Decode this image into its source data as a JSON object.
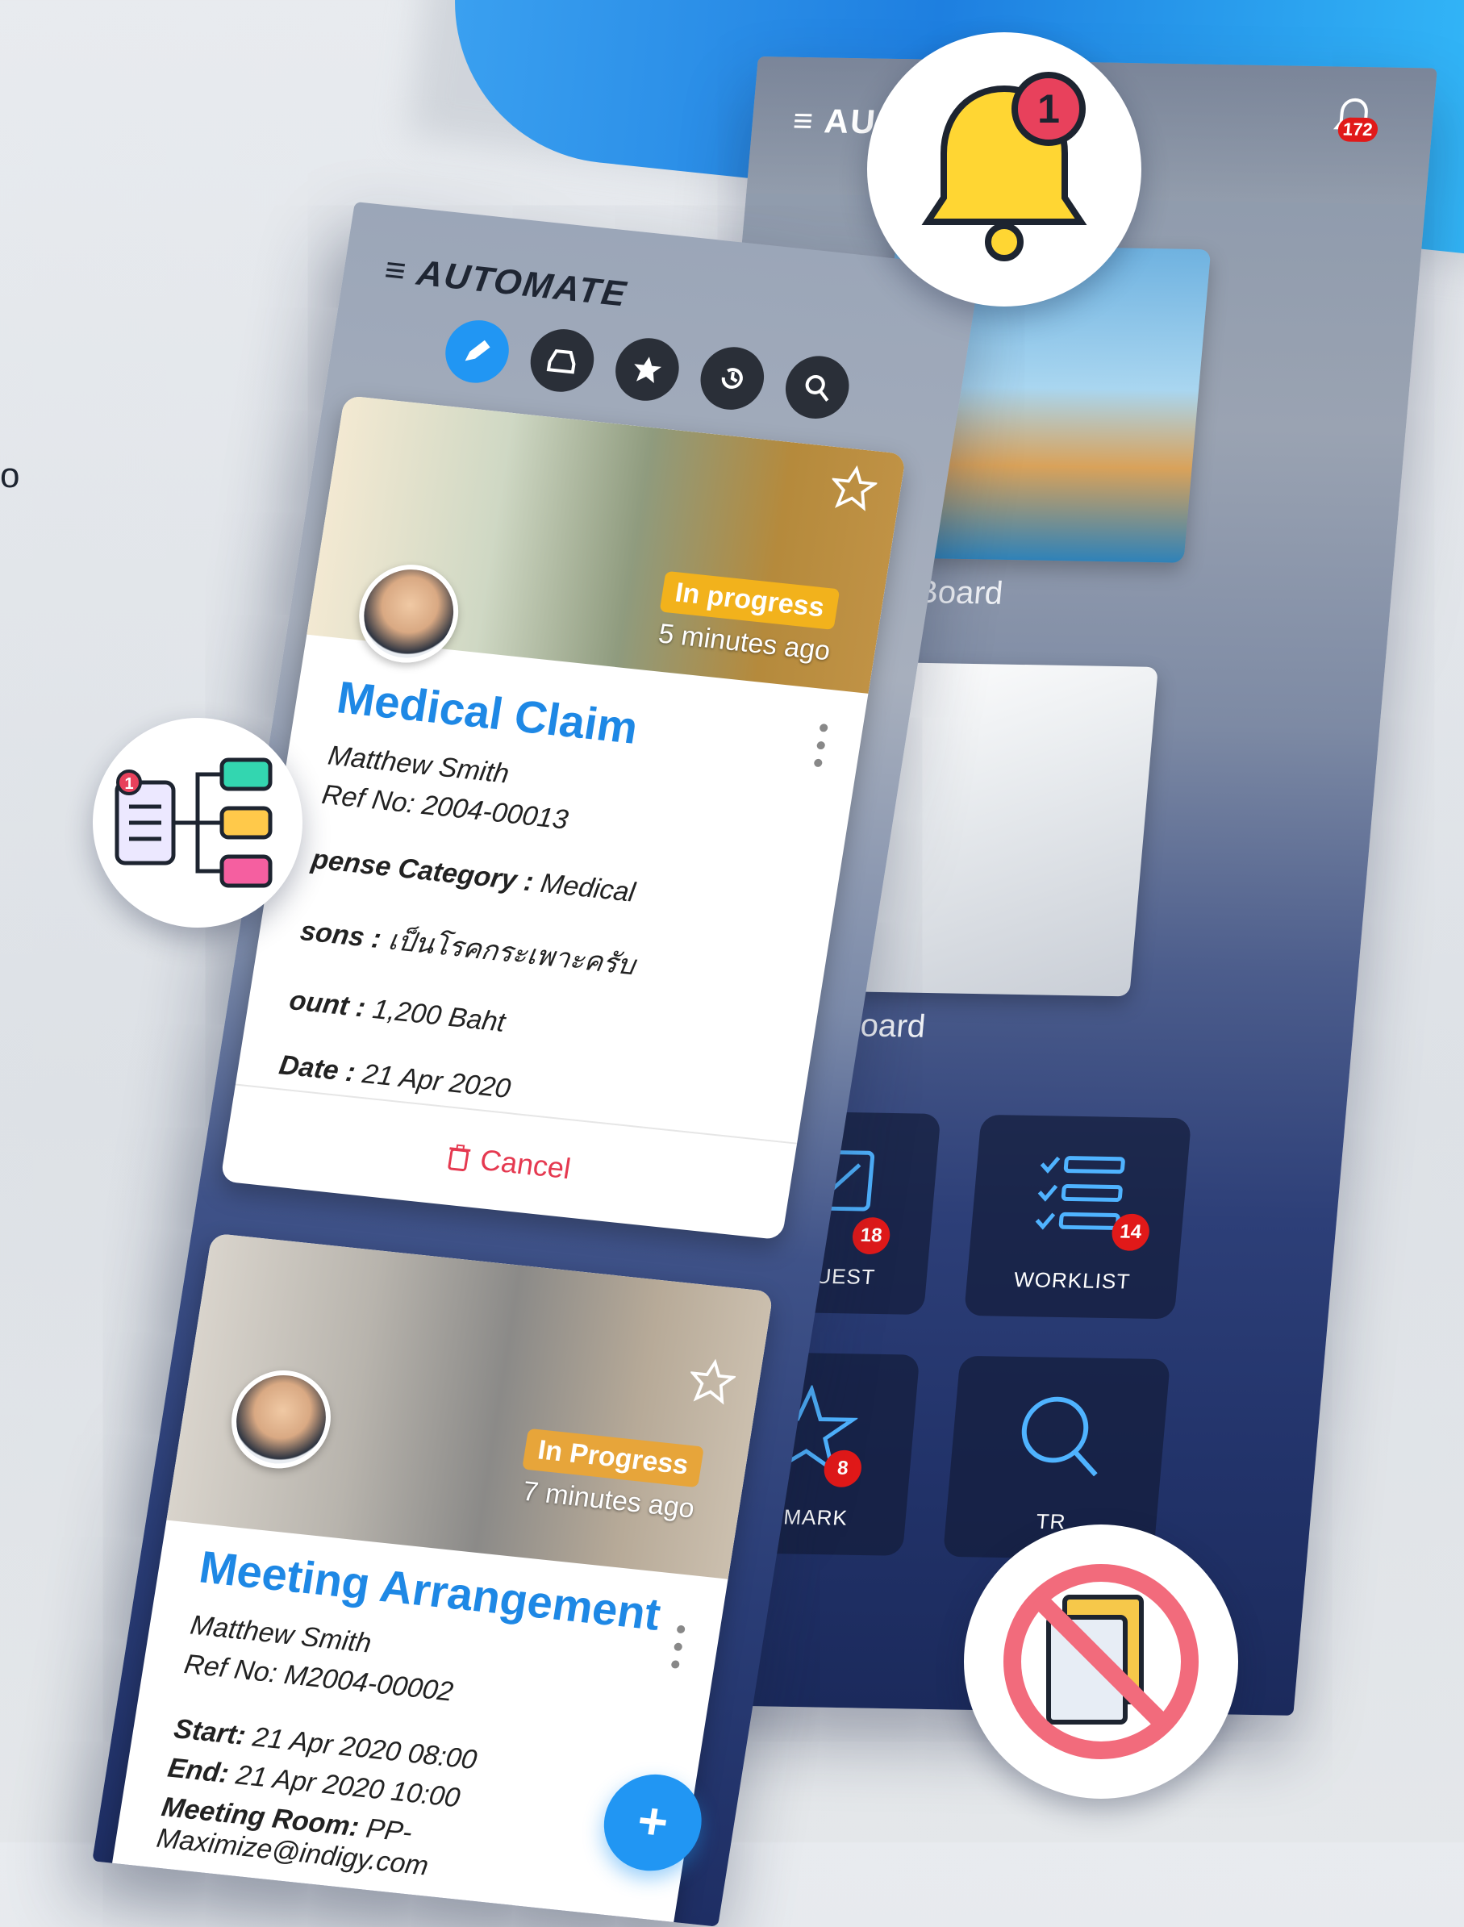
{
  "back_screen": {
    "app_title_partial": "AU",
    "notification_count": "172",
    "boards": [
      {
        "label": "ve Board"
      },
      {
        "label": "rk Board"
      }
    ],
    "tiles": [
      {
        "label": "REQUEST",
        "badge": "18"
      },
      {
        "label": "WORKLIST",
        "badge": "14"
      },
      {
        "label": "TOMARK",
        "badge": "8"
      },
      {
        "label": "TR"
      }
    ]
  },
  "front_screen": {
    "app_title": "AUTOMATE",
    "toolbar_icons": [
      "pencil-icon",
      "inbox-icon",
      "star-icon",
      "history-icon",
      "search-icon"
    ],
    "cards": [
      {
        "title": "Medical Claim",
        "requester": "Matthew Smith",
        "ref": "Ref No: 2004-00013",
        "status": "In progress",
        "time_ago": "5 minutes ago",
        "fields": [
          {
            "label": "pense Category :",
            "value": " Medical"
          },
          {
            "label": "sons :",
            "value": " เป็นโรคกระเพาะครับ"
          },
          {
            "label": "ount :",
            "value": " 1,200 Baht"
          },
          {
            "label": "Date :",
            "value": " 21 Apr 2020"
          }
        ],
        "action": "Cancel"
      },
      {
        "title": "Meeting Arrangement",
        "requester": "Matthew Smith",
        "ref": "Ref No: M2004-00002",
        "status": "In Progress",
        "time_ago": "7 minutes ago",
        "fields": [
          {
            "label": "Start:",
            "value": " 21 Apr 2020 08:00"
          },
          {
            "label": "End:",
            "value": " 21 Apr 2020 10:00"
          },
          {
            "label": "Meeting Room:",
            "value": " PP-Maximize@indigy.com"
          }
        ]
      }
    ],
    "fab_label": "+"
  },
  "decor": {
    "bell_badge": "1",
    "flow_badge": "1",
    "edge_glyph": "o"
  },
  "colors": {
    "accent": "#2196f3",
    "status": "#f2b21c",
    "danger": "#e53950",
    "badge": "#e11919"
  }
}
